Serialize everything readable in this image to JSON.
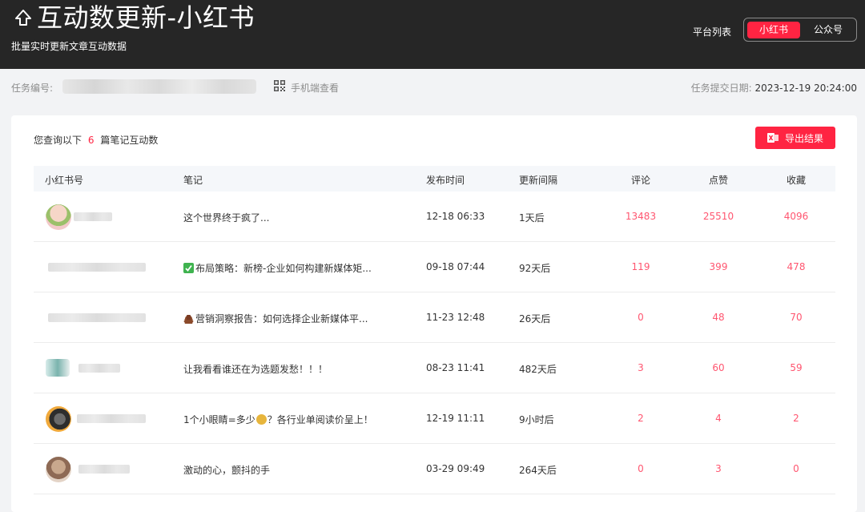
{
  "header": {
    "title": "互动数更新-小红书",
    "subtitle": "批量实时更新文章互动数据",
    "platform_label": "平台列表",
    "platforms": [
      "小红书",
      "公众号"
    ]
  },
  "info": {
    "task_label": "任务编号:",
    "mobile_view": "手机端查看",
    "date_label": "任务提交日期:",
    "date_value": "2023-12-19 20:24:00"
  },
  "summary": {
    "prefix": "您查询以下",
    "count": "6",
    "suffix": "篇笔记互动数",
    "export_label": "导出结果"
  },
  "table": {
    "headers": [
      "小红书号",
      "笔记",
      "发布时间",
      "更新间隔",
      "评论",
      "点赞",
      "收藏"
    ],
    "rows": [
      {
        "note": "这个世界终于疯了...",
        "time": "12-18 06:33",
        "gap": "1天后",
        "comment": "13483",
        "like": "25510",
        "fav": "4096"
      },
      {
        "note": "布局策略：新榜-企业如何构建新媒体矩...",
        "time": "09-18 07:44",
        "gap": "92天后",
        "comment": "119",
        "like": "399",
        "fav": "478"
      },
      {
        "note": "营销洞察报告：如何选择企业新媒体平...",
        "time": "11-23 12:48",
        "gap": "26天后",
        "comment": "0",
        "like": "48",
        "fav": "70"
      },
      {
        "note": "让我看看谁还在为选题发愁！！！",
        "time": "08-23 11:41",
        "gap": "482天后",
        "comment": "3",
        "like": "60",
        "fav": "59"
      },
      {
        "note": "1个小眼睛=多少",
        "note_tail": "？各行业单阅读价呈上！",
        "time": "12-19 11:11",
        "gap": "9小时后",
        "comment": "2",
        "like": "4",
        "fav": "2"
      },
      {
        "note": "激动的心，颤抖的手",
        "time": "03-29 09:49",
        "gap": "264天后",
        "comment": "0",
        "like": "3",
        "fav": "0"
      }
    ]
  },
  "colors": {
    "accent": "#ff2442",
    "number": "#ff5670",
    "header_bg": "#262626"
  }
}
